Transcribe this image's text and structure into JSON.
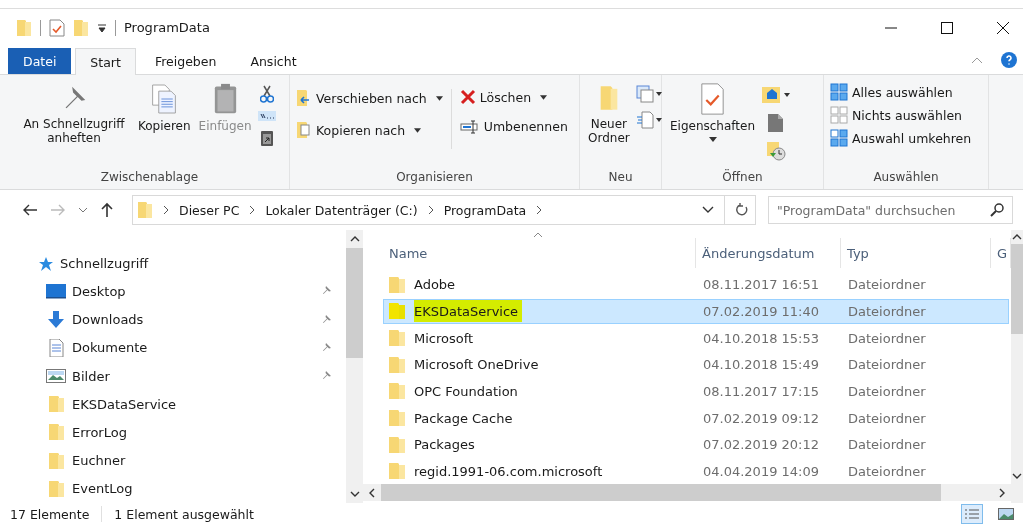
{
  "window": {
    "title": "ProgramData"
  },
  "tabs": [
    {
      "label": "Datei",
      "kind": "file",
      "selected": false
    },
    {
      "label": "Start",
      "kind": "tab",
      "selected": true
    },
    {
      "label": "Freigeben",
      "kind": "tab",
      "selected": false
    },
    {
      "label": "Ansicht",
      "kind": "tab",
      "selected": false
    }
  ],
  "ribbon": {
    "groups": [
      {
        "label": "Zwischenablage",
        "items": [
          {
            "label": "An Schnellzugriff anheften",
            "disabled": false
          },
          {
            "label": "Kopieren",
            "disabled": false
          },
          {
            "label": "Einfügen",
            "disabled": true
          }
        ]
      },
      {
        "label": "Organisieren",
        "items": [
          {
            "label": "Verschieben nach",
            "dropdown": true
          },
          {
            "label": "Kopieren nach",
            "dropdown": true
          },
          {
            "label": "Löschen",
            "dropdown": true
          },
          {
            "label": "Umbenennen",
            "dropdown": false
          }
        ]
      },
      {
        "label": "Neu",
        "items": [
          {
            "label": "Neuer Ordner"
          }
        ]
      },
      {
        "label": "Öffnen",
        "items": [
          {
            "label": "Eigenschaften"
          }
        ]
      },
      {
        "label": "Auswählen",
        "items": [
          {
            "label": "Alles auswählen"
          },
          {
            "label": "Nichts auswählen"
          },
          {
            "label": "Auswahl umkehren"
          }
        ]
      }
    ]
  },
  "address": {
    "path": [
      "Dieser PC",
      "Lokaler Datenträger (C:)",
      "ProgramData"
    ]
  },
  "search": {
    "placeholder": "\"ProgramData\" durchsuchen"
  },
  "sidebar": {
    "items": [
      {
        "label": "Schnellzugriff",
        "children": [
          {
            "label": "Desktop",
            "pinned": true
          },
          {
            "label": "Downloads",
            "pinned": true
          },
          {
            "label": "Dokumente",
            "pinned": true
          },
          {
            "label": "Bilder",
            "pinned": true
          },
          {
            "label": "EKSDataService",
            "pinned": false
          },
          {
            "label": "ErrorLog",
            "pinned": false
          },
          {
            "label": "Euchner",
            "pinned": false
          },
          {
            "label": "EventLog",
            "pinned": false
          }
        ]
      }
    ]
  },
  "table": {
    "columns": [
      "Name",
      "Änderungsdatum",
      "Typ",
      "G"
    ],
    "rows": [
      {
        "name": "Adobe",
        "date": "08.11.2017 16:51",
        "type": "Dateiordner",
        "selected": false,
        "highlighted": false
      },
      {
        "name": "EKSDataService",
        "date": "07.02.2019 11:40",
        "type": "Dateiordner",
        "selected": true,
        "highlighted": true
      },
      {
        "name": "Microsoft",
        "date": "04.10.2018 15:53",
        "type": "Dateiordner",
        "selected": false,
        "highlighted": false
      },
      {
        "name": "Microsoft OneDrive",
        "date": "04.10.2018 15:49",
        "type": "Dateiordner",
        "selected": false,
        "highlighted": false
      },
      {
        "name": "OPC Foundation",
        "date": "08.11.2017 17:15",
        "type": "Dateiordner",
        "selected": false,
        "highlighted": false
      },
      {
        "name": "Package Cache",
        "date": "07.02.2019 09:12",
        "type": "Dateiordner",
        "selected": false,
        "highlighted": false
      },
      {
        "name": "Packages",
        "date": "07.02.2019 20:12",
        "type": "Dateiordner",
        "selected": false,
        "highlighted": false
      },
      {
        "name": "regid.1991-06.com.microsoft",
        "date": "04.04.2019 14:09",
        "type": "Dateiordner",
        "selected": false,
        "highlighted": false
      }
    ]
  },
  "status_bar": {
    "count": "17 Elemente",
    "selection": "1 Element ausgewählt",
    "views": [
      {
        "selected": true
      },
      {
        "selected": false
      }
    ]
  }
}
